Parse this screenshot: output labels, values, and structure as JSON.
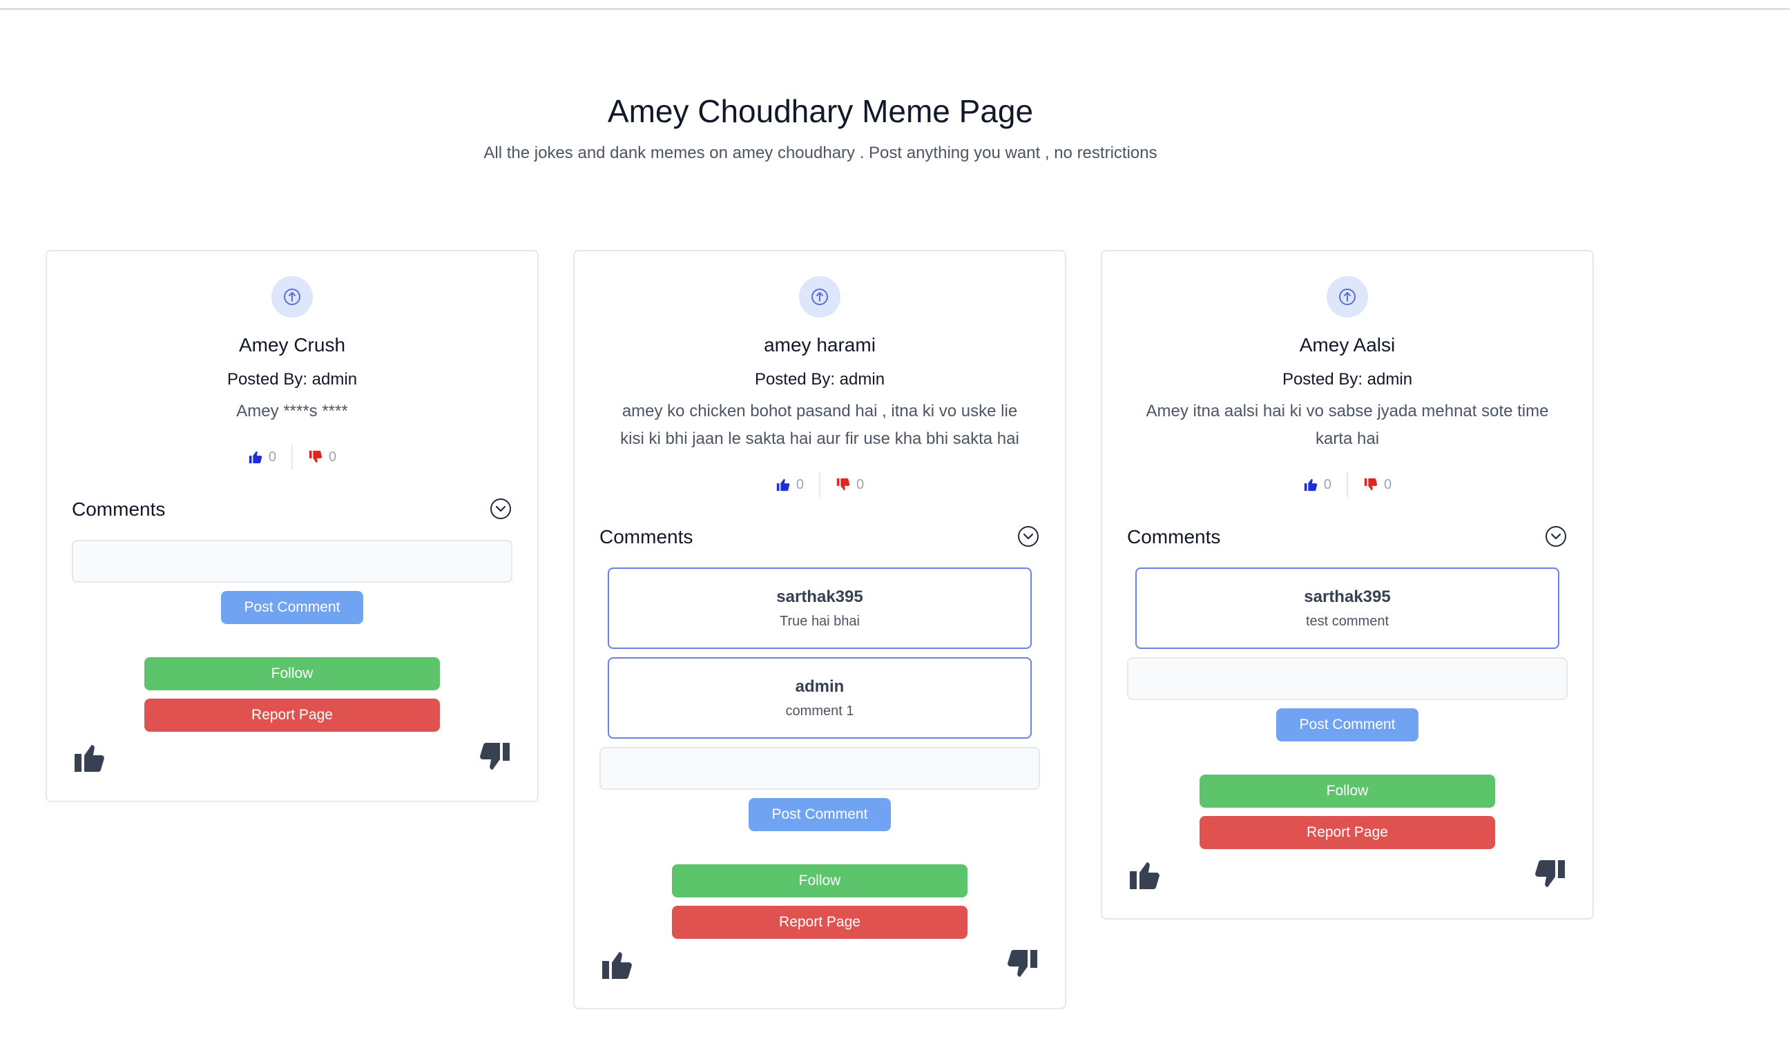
{
  "header": {
    "title": "Amey Choudhary Meme Page",
    "subtitle": "All the jokes and dank memes on amey choudhary . Post anything you want , no restrictions"
  },
  "colors": {
    "like_small": "#1d2fd6",
    "dislike_small": "#e0261f",
    "post_button": "#70a4f2",
    "follow_button": "#5cc46a",
    "report_button": "#e05250",
    "comment_border": "#6d7fe0"
  },
  "posts": [
    {
      "title": "Amey Crush",
      "posted_by": "Posted By: admin",
      "body": "Amey ****s ****",
      "likes": "0",
      "dislikes": "0",
      "comments_label": "Comments",
      "comments": [],
      "comment_input_value": "",
      "post_comment_label": "Post Comment",
      "follow_label": "Follow",
      "report_label": "Report Page"
    },
    {
      "title": "amey harami",
      "posted_by": "Posted By: admin",
      "body": "amey ko chicken bohot pasand hai , itna ki vo uske lie kisi ki bhi jaan le sakta hai aur fir use kha bhi sakta hai",
      "likes": "0",
      "dislikes": "0",
      "comments_label": "Comments",
      "comments": [
        {
          "user": "sarthak395",
          "text": "True hai bhai"
        },
        {
          "user": "admin",
          "text": "comment 1"
        }
      ],
      "comment_input_value": "",
      "post_comment_label": "Post Comment",
      "follow_label": "Follow",
      "report_label": "Report Page"
    },
    {
      "title": "Amey Aalsi",
      "posted_by": "Posted By: admin",
      "body": "Amey itna aalsi hai ki vo sabse jyada mehnat sote time karta hai",
      "likes": "0",
      "dislikes": "0",
      "comments_label": "Comments",
      "comments": [
        {
          "user": "sarthak395",
          "text": "test comment"
        }
      ],
      "comment_input_value": "",
      "post_comment_label": "Post Comment",
      "follow_label": "Follow",
      "report_label": "Report Page"
    }
  ],
  "icons": [
    "upload-icon",
    "thumbs-up-icon",
    "thumbs-down-icon",
    "chevron-down-circle-icon",
    "thumbs-up-large-icon",
    "thumbs-down-large-icon"
  ]
}
